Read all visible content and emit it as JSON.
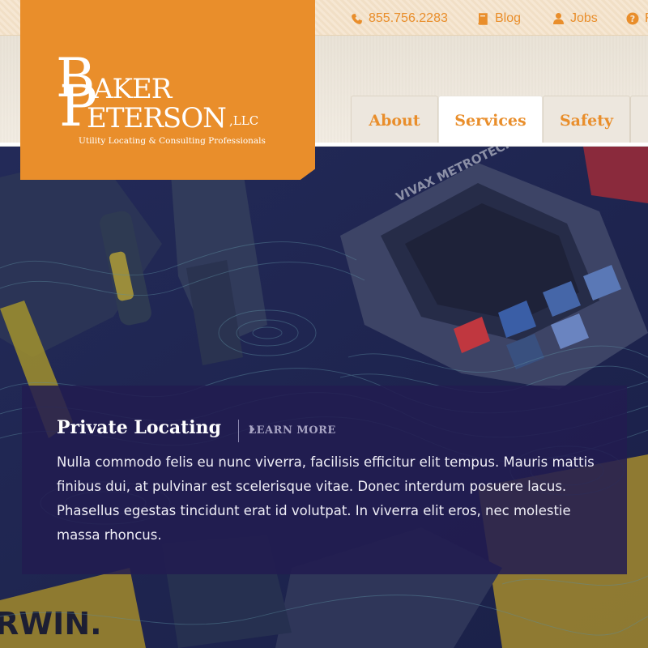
{
  "utility_nav": {
    "phone": "855.756.2283",
    "blog": "Blog",
    "jobs": "Jobs",
    "help": "F",
    "icons": [
      "phone-icon",
      "book-icon",
      "user-icon",
      "question-icon"
    ]
  },
  "logo": {
    "initial_b": "B",
    "initial_p": "P",
    "line1": "AKER",
    "line2": "ETERSON",
    "suffix": ",LLC",
    "tagline": "Utility Locating & Consulting Professionals"
  },
  "nav": {
    "tabs": [
      {
        "label": "About",
        "active": false
      },
      {
        "label": "Services",
        "active": true
      },
      {
        "label": "Safety",
        "active": false
      },
      {
        "label": "",
        "active": false
      }
    ]
  },
  "hero": {
    "device_brand": "VIVAX METROTECH",
    "tool_brand": "RWIN.",
    "caption": {
      "title": "Private Locating",
      "link": "LEARN MORE",
      "body": "Nulla commodo felis eu nunc viverra, facilisis efficitur elit tempus. Mauris mattis finibus dui, at pulvinar est scelerisque vitae. Donec interdum posuere lacus. Phasellus egestas tincidunt erat id volutpat. In viverra elit eros, nec molestie massa rhoncus."
    }
  },
  "colors": {
    "brand_orange": "#e98e2b",
    "hero_navy": "#1d2450",
    "caption_bg": "#221c50",
    "white": "#ffffff"
  }
}
